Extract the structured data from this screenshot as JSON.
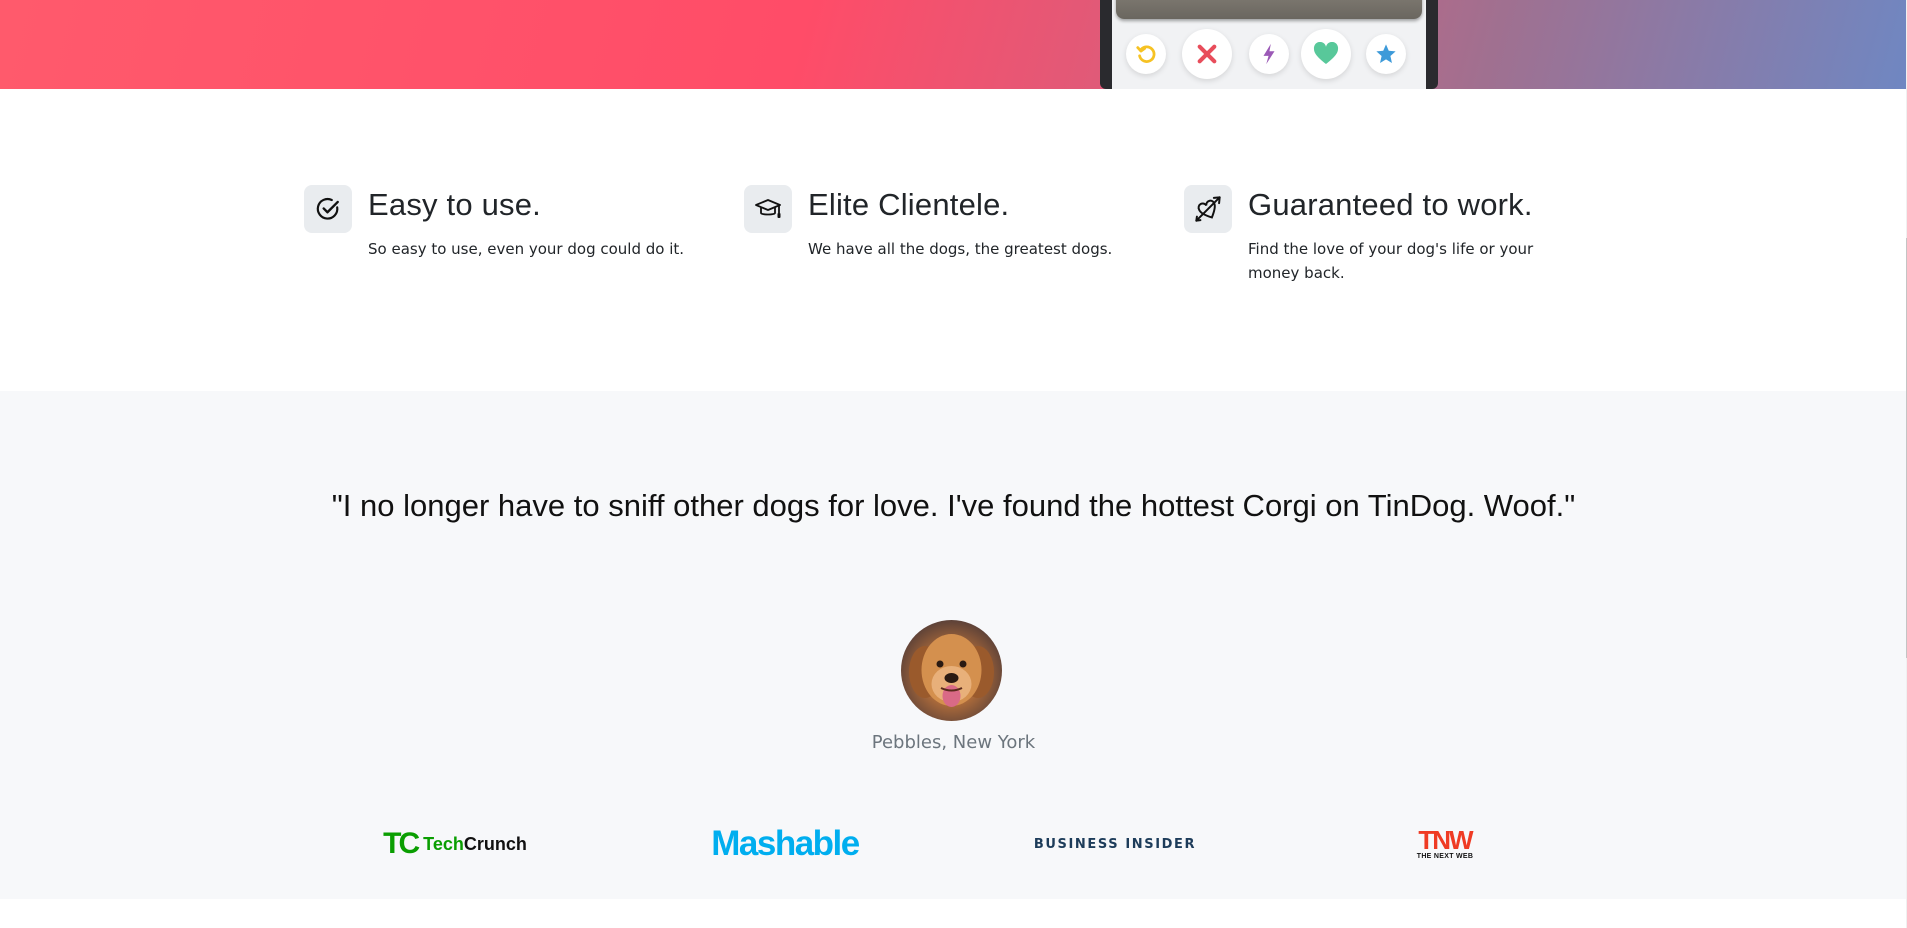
{
  "hero": {
    "accent_colors": [
      "#ff4c68",
      "#6f87c2"
    ],
    "phone_actions": [
      {
        "name": "rewind",
        "icon": "rewind-icon",
        "color": "#f6c223"
      },
      {
        "name": "nope",
        "icon": "close-icon",
        "color": "#e84d5b"
      },
      {
        "name": "boost",
        "icon": "lightning-icon",
        "color": "#9b59b6"
      },
      {
        "name": "like",
        "icon": "heart-icon",
        "color": "#58c89a"
      },
      {
        "name": "super-like",
        "icon": "star-icon",
        "color": "#3d9ad9"
      }
    ]
  },
  "features": [
    {
      "icon": "check-circle-icon",
      "title": "Easy to use.",
      "text": "So easy to use, even your dog could do it."
    },
    {
      "icon": "mortarboard-icon",
      "title": "Elite Clientele.",
      "text": "We have all the dogs, the greatest dogs."
    },
    {
      "icon": "heart-arrow-icon",
      "title": "Guaranteed to work.",
      "text": "Find the love of your dog's life or your money back."
    }
  ],
  "testimonial": {
    "quote": "\"I no longer have to sniff other dogs for love. I've found the hottest Corgi on TinDog. Woof.\"",
    "author": "Pebbles, New York",
    "avatar_icon": "dog-avatar"
  },
  "press": {
    "techcrunch": {
      "mark": "TC",
      "word_a": "Tech",
      "word_b": "Crunch",
      "color": "#0a9e01"
    },
    "mashable": {
      "text": "Mashable",
      "color": "#00aeef"
    },
    "business_insider": {
      "text": "BUSINESS INSIDER",
      "color": "#1d3c5a"
    },
    "tnw": {
      "big": "TNW",
      "small": "THE NEXT WEB",
      "color": "#ef3b24"
    }
  }
}
